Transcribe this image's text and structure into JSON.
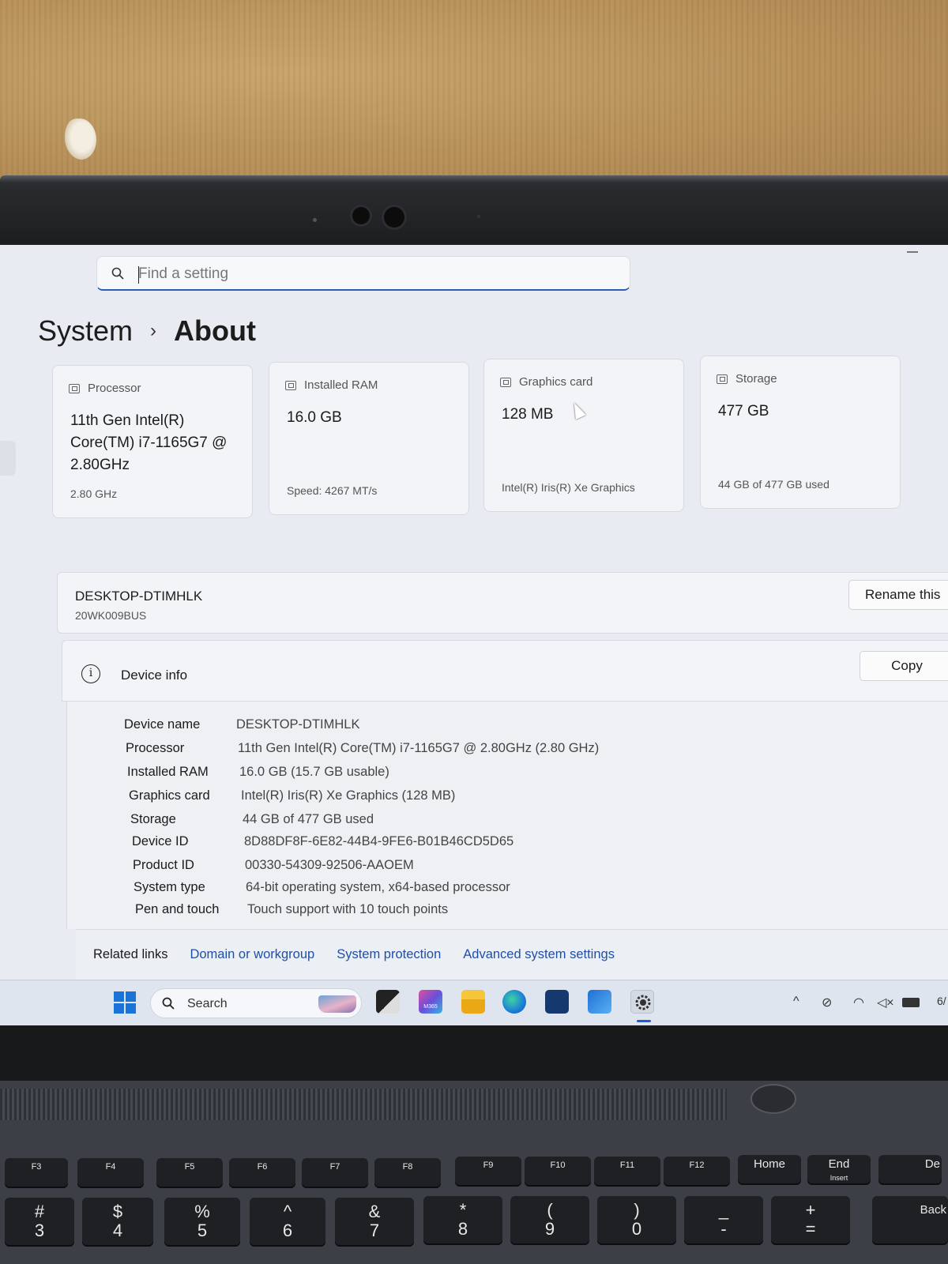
{
  "search": {
    "placeholder": "Find a setting"
  },
  "breadcrumb": {
    "parent": "System",
    "separator": "›",
    "current": "About"
  },
  "cards": [
    {
      "title": "Processor",
      "value": "11th Gen Intel(R) Core(TM) i7-1165G7 @ 2.80GHz",
      "sub": "2.80 GHz"
    },
    {
      "title": "Installed RAM",
      "value": "16.0 GB",
      "sub": "Speed: 4267 MT/s"
    },
    {
      "title": "Graphics card",
      "value": "128 MB",
      "sub": "Intel(R) Iris(R) Xe Graphics"
    },
    {
      "title": "Storage",
      "value": "477 GB",
      "sub": "44 GB of 477 GB used"
    }
  ],
  "device": {
    "name": "DESKTOP-DTIMHLK",
    "model": "20WK009BUS",
    "rename_label": "Rename this"
  },
  "device_info": {
    "title": "Device info",
    "copy_label": "Copy",
    "rows": [
      {
        "key": "Device name",
        "value": "DESKTOP-DTIMHLK"
      },
      {
        "key": "Processor",
        "value": "11th Gen Intel(R) Core(TM) i7-1165G7 @ 2.80GHz (2.80 GHz)"
      },
      {
        "key": "Installed RAM",
        "value": "16.0 GB (15.7 GB usable)"
      },
      {
        "key": "Graphics card",
        "value": "Intel(R) Iris(R) Xe Graphics (128 MB)"
      },
      {
        "key": "Storage",
        "value": "44 GB of 477 GB used"
      },
      {
        "key": "Device ID",
        "value": "8D88DF8F-6E82-44B4-9FE6-B01B46CD5D65"
      },
      {
        "key": "Product ID",
        "value": "00330-54309-92506-AAOEM"
      },
      {
        "key": "System type",
        "value": "64-bit operating system, x64-based processor"
      },
      {
        "key": "Pen and touch",
        "value": "Touch support with 10 touch points"
      }
    ]
  },
  "related": {
    "label": "Related links",
    "links": [
      "Domain or workgroup",
      "System protection",
      "Advanced system settings"
    ]
  },
  "taskbar": {
    "search_label": "Search",
    "apps": [
      "file-explorer-icon",
      "microsoft-365-icon",
      "folder-icon",
      "edge-icon",
      "store-icon",
      "outlook-icon",
      "settings-icon"
    ],
    "m365_badge": "M365",
    "clock_partial": "6/"
  },
  "keyboard": {
    "fn_keys": [
      "F3",
      "F4",
      "F5",
      "F6",
      "F7",
      "F8",
      "F9",
      "F10",
      "F11",
      "F12"
    ],
    "home": "Home",
    "end": "End",
    "insert": "Insert",
    "del_partial": "De",
    "num_keys": [
      {
        "top": "#",
        "bottom": "3"
      },
      {
        "top": "$",
        "bottom": "4"
      },
      {
        "top": "%",
        "bottom": "5"
      },
      {
        "top": "^",
        "bottom": "6"
      },
      {
        "top": "&",
        "bottom": "7"
      },
      {
        "top": "*",
        "bottom": "8"
      },
      {
        "top": "(",
        "bottom": "9"
      },
      {
        "top": ")",
        "bottom": "0"
      },
      {
        "top": "_",
        "bottom": "-"
      },
      {
        "top": "+",
        "bottom": "="
      }
    ],
    "backspace_partial": "Back"
  },
  "colors": {
    "accent": "#1f4fa8",
    "window_bg": "#e8ecf2",
    "card_bg": "#f2f4f7"
  }
}
